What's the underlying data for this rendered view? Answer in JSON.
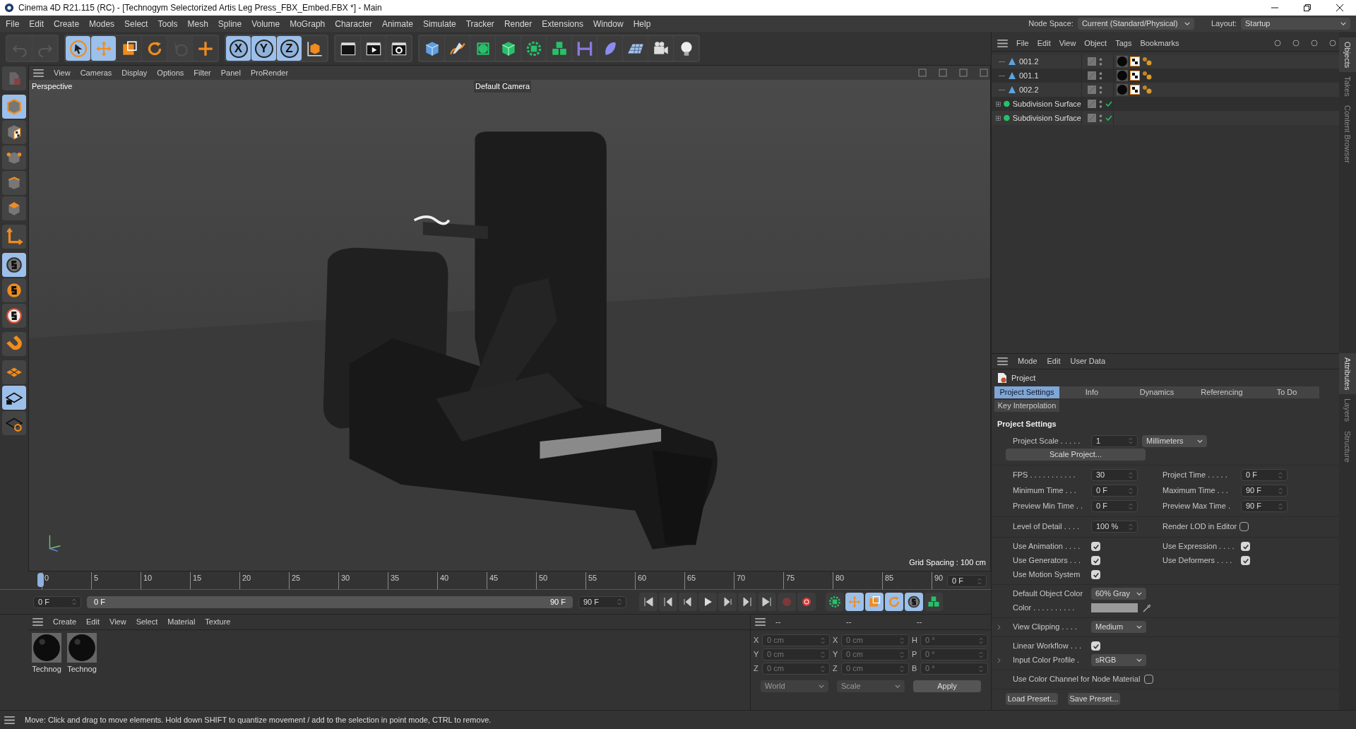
{
  "window": {
    "title": "Cinema 4D R21.115 (RC) - [Technogym Selectorized Artis Leg Press_FBX_Embed.FBX *] - Main"
  },
  "menu": [
    "File",
    "Edit",
    "Create",
    "Modes",
    "Select",
    "Tools",
    "Mesh",
    "Spline",
    "Volume",
    "MoGraph",
    "Character",
    "Animate",
    "Simulate",
    "Tracker",
    "Render",
    "Extensions",
    "Window",
    "Help"
  ],
  "node_space": {
    "label": "Node Space:",
    "value": "Current (Standard/Physical)"
  },
  "layout": {
    "label": "Layout:",
    "value": "Startup"
  },
  "toolbar": [
    [
      {
        "kind": "undo",
        "selected": false,
        "disabled": true
      },
      {
        "kind": "redo",
        "selected": false,
        "disabled": true
      }
    ],
    [
      {
        "kind": "select",
        "selected": true,
        "disabled": false
      },
      {
        "kind": "move",
        "selected": true,
        "disabled": false
      },
      {
        "kind": "scale",
        "selected": false,
        "disabled": false
      },
      {
        "kind": "rotate",
        "selected": false,
        "disabled": false
      },
      {
        "kind": "recent",
        "selected": false,
        "disabled": true
      },
      {
        "kind": "plus",
        "selected": false,
        "disabled": false
      }
    ],
    [
      {
        "kind": "axis",
        "text": "X",
        "selected": true,
        "disabled": false
      },
      {
        "kind": "axis",
        "text": "Y",
        "selected": true,
        "disabled": false
      },
      {
        "kind": "axis",
        "text": "Z",
        "selected": true,
        "disabled": false
      },
      {
        "kind": "coord",
        "selected": false,
        "disabled": false
      }
    ],
    [
      {
        "kind": "clapper",
        "selected": false,
        "disabled": false
      },
      {
        "kind": "clapper-play",
        "selected": false,
        "disabled": false
      },
      {
        "kind": "clapper-gear",
        "selected": false,
        "disabled": false
      }
    ],
    [
      {
        "kind": "cube",
        "selected": false,
        "disabled": false
      },
      {
        "kind": "pen",
        "selected": false,
        "disabled": false
      },
      {
        "kind": "green-sphere",
        "selected": false,
        "disabled": false
      },
      {
        "kind": "green-cube",
        "selected": false,
        "disabled": false
      },
      {
        "kind": "green-gear",
        "selected": false,
        "disabled": false
      },
      {
        "kind": "green-cubes",
        "selected": false,
        "disabled": false
      },
      {
        "kind": "field",
        "selected": false,
        "disabled": false
      },
      {
        "kind": "deformer",
        "selected": false,
        "disabled": false
      },
      {
        "kind": "floor",
        "selected": false,
        "disabled": false
      },
      {
        "kind": "camera",
        "selected": false,
        "disabled": false
      },
      {
        "kind": "bulb",
        "selected": false,
        "disabled": false
      }
    ]
  ],
  "left_tools": [
    [
      {
        "kind": "model",
        "selected": false
      }
    ],
    [
      {
        "kind": "object-mode",
        "selected": true
      },
      {
        "kind": "texture",
        "selected": false
      },
      {
        "kind": "points",
        "selected": false
      },
      {
        "kind": "edges",
        "selected": false
      },
      {
        "kind": "polygons",
        "selected": false
      }
    ],
    [
      {
        "kind": "axis-tool",
        "selected": false
      }
    ],
    [
      {
        "kind": "snap",
        "selected": true
      },
      {
        "kind": "snap-orange",
        "selected": false
      },
      {
        "kind": "snap-ring",
        "selected": false
      }
    ],
    [
      {
        "kind": "magnet",
        "selected": false
      }
    ],
    [
      {
        "kind": "workplane",
        "selected": false
      },
      {
        "kind": "workplane-lock",
        "selected": true
      },
      {
        "kind": "workplane-sync",
        "selected": false
      }
    ]
  ],
  "viewport": {
    "menu": [
      "View",
      "Cameras",
      "Display",
      "Options",
      "Filter",
      "Panel",
      "ProRender"
    ],
    "label": "Perspective",
    "camera": "Default Camera",
    "grid": "Grid Spacing : 100 cm"
  },
  "timeline": {
    "ticks": [
      "0",
      "5",
      "10",
      "15",
      "20",
      "25",
      "30",
      "35",
      "40",
      "45",
      "50",
      "55",
      "60",
      "65",
      "70",
      "75",
      "80",
      "85",
      "90"
    ],
    "current": "0 F",
    "start": "0 F",
    "range": {
      "start": "0 F",
      "end": "90 F",
      "level": 1
    },
    "end": "90 F"
  },
  "materials": {
    "menu": [
      "Create",
      "Edit",
      "View",
      "Select",
      "Material",
      "Texture"
    ],
    "items": [
      {
        "name": "Technog"
      },
      {
        "name": "Technog"
      }
    ]
  },
  "coordinates": {
    "headers": [
      "--",
      "--",
      "--"
    ],
    "rows": [
      [
        {
          "axis": "X",
          "value": "0 cm",
          "disabled": true
        },
        {
          "axis": "X",
          "value": "0 cm",
          "disabled": true
        },
        {
          "axis": "H",
          "value": "0 °",
          "disabled": true
        }
      ],
      [
        {
          "axis": "Y",
          "value": "0 cm",
          "disabled": true
        },
        {
          "axis": "Y",
          "value": "0 cm",
          "disabled": true
        },
        {
          "axis": "P",
          "value": "0 °",
          "disabled": true
        }
      ],
      [
        {
          "axis": "Z",
          "value": "0 cm",
          "disabled": true
        },
        {
          "axis": "Z",
          "value": "0 cm",
          "disabled": true
        },
        {
          "axis": "B",
          "value": "0 °",
          "disabled": true
        }
      ]
    ],
    "space": "World",
    "mode": "Scale",
    "apply": "Apply"
  },
  "status_bar": "Move: Click and drag to move elements. Hold down SHIFT to quantize movement / add to the selection in point mode, CTRL to remove.",
  "objects": {
    "menu": [
      "File",
      "Edit",
      "View",
      "Object",
      "Tags",
      "Bookmarks"
    ],
    "rows": [
      {
        "name": "001.2",
        "kind": "polygon"
      },
      {
        "name": "001.1",
        "kind": "polygon"
      },
      {
        "name": "002.2",
        "kind": "polygon"
      },
      {
        "name": "Subdivision Surface",
        "kind": "subdivision"
      },
      {
        "name": "Subdivision Surface",
        "kind": "subdivision"
      }
    ],
    "side_tabs": [
      {
        "label": "Objects",
        "selected": true
      },
      {
        "label": "Takes",
        "selected": false
      },
      {
        "label": "Content Browser",
        "selected": false
      }
    ]
  },
  "attributes": {
    "menu": [
      "Mode",
      "Edit",
      "User Data"
    ],
    "title": "Project",
    "tabs": [
      {
        "label": "Project Settings",
        "selected": true
      },
      {
        "label": "Info",
        "selected": false
      },
      {
        "label": "Dynamics",
        "selected": false
      },
      {
        "label": "Referencing",
        "selected": false
      },
      {
        "label": "To Do",
        "selected": false
      },
      {
        "label": "Key Interpolation",
        "selected": false
      }
    ],
    "section": "Project Settings",
    "scale": {
      "label": "Project Scale . . . . .",
      "value": "1",
      "unit": "Millimeters",
      "button": "Scale Project..."
    },
    "time_fields": [
      {
        "label": "FPS . . . . . . . . . . .",
        "value": "30"
      },
      {
        "label": "Project Time . . . . .",
        "value": "0 F"
      },
      {
        "label": "Minimum Time . . .",
        "value": "0 F"
      },
      {
        "label": "Maximum Time . . .",
        "value": "90 F"
      },
      {
        "label": "Preview Min Time . .",
        "value": "0 F"
      },
      {
        "label": "Preview Max Time .",
        "value": "90 F"
      }
    ],
    "lod": {
      "label": "Level of Detail . . . .",
      "value": "100 %"
    },
    "render_lod": {
      "label": "Render LOD in Editor",
      "checked": false
    },
    "flags": [
      {
        "label": "Use Animation . . . .",
        "checked": true
      },
      {
        "label": "Use Expression . . . .",
        "checked": true
      },
      {
        "label": "Use Generators . . .",
        "checked": true
      },
      {
        "label": "Use Deformers . . . .",
        "checked": true
      },
      {
        "label": "Use Motion System",
        "checked": true
      }
    ],
    "default_color": {
      "label": "Default Object Color",
      "value": "60% Gray"
    },
    "color": {
      "label": "Color . . . . . . . . . ."
    },
    "view_clipping": {
      "label": "View Clipping . . . .",
      "value": "Medium"
    },
    "linear_workflow": {
      "label": "Linear Workflow . . .",
      "checked": true
    },
    "input_profile": {
      "label": "Input Color Profile .",
      "value": "sRGB"
    },
    "node_material": {
      "label": "Use Color Channel for Node Material",
      "checked": false
    },
    "presets": [
      "Load Preset...",
      "Save Preset..."
    ],
    "side_tabs": [
      {
        "label": "Attributes",
        "selected": true
      },
      {
        "label": "Layers",
        "selected": false
      },
      {
        "label": "Structure",
        "selected": false
      }
    ]
  }
}
